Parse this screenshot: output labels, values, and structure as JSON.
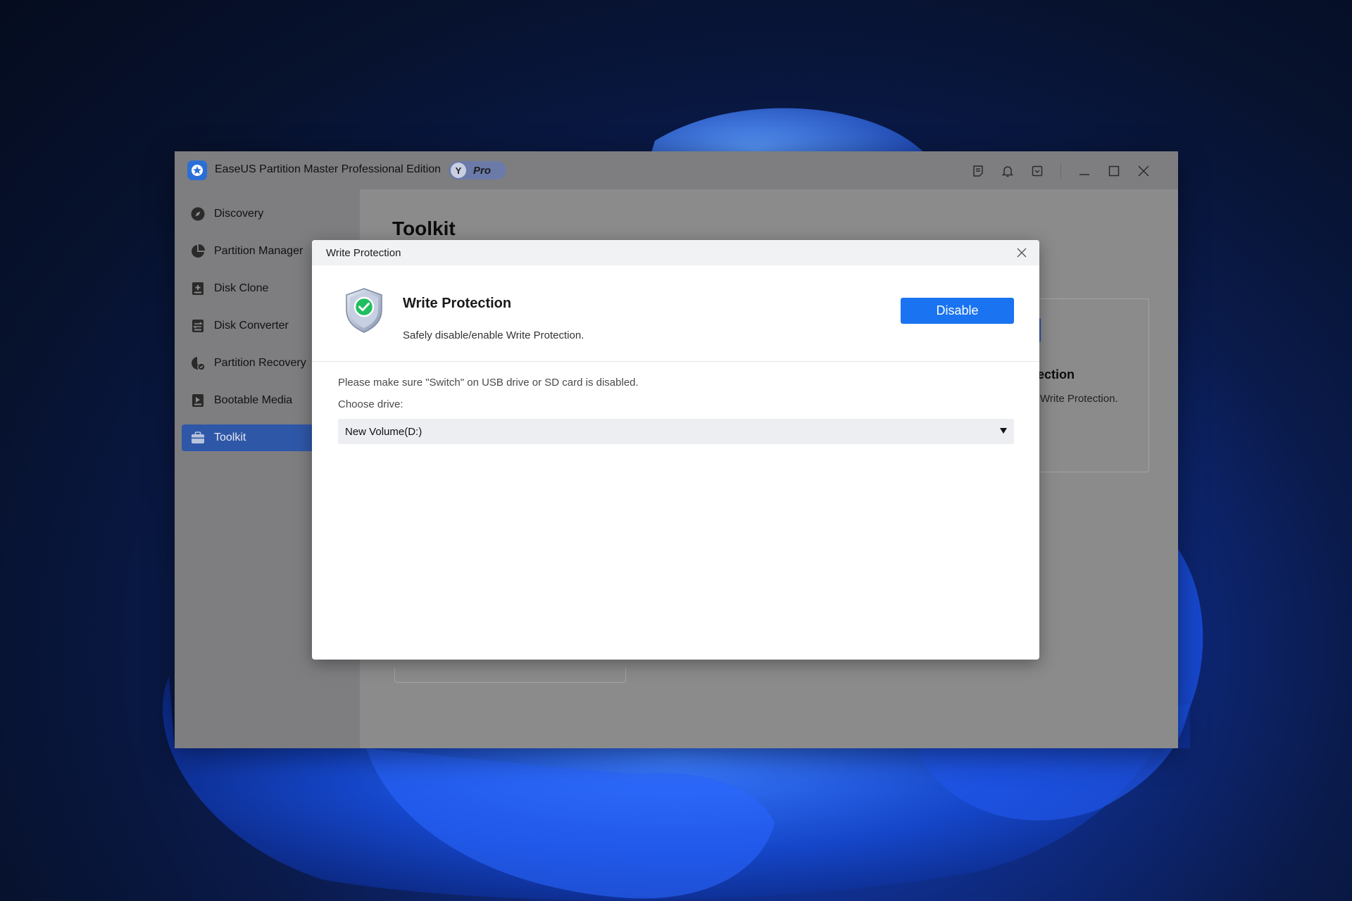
{
  "window": {
    "title": "EaseUS Partition Master Professional Edition",
    "badge_letter": "Y",
    "badge_label": "Pro"
  },
  "sidebar": {
    "items": [
      {
        "label": "Discovery",
        "icon": "compass-icon"
      },
      {
        "label": "Partition Manager",
        "icon": "pie-chart-icon"
      },
      {
        "label": "Disk Clone",
        "icon": "disk-clone-icon"
      },
      {
        "label": "Disk Converter",
        "icon": "disk-converter-icon"
      },
      {
        "label": "Partition Recovery",
        "icon": "partition-recovery-icon"
      },
      {
        "label": "Bootable Media",
        "icon": "bootable-media-icon"
      },
      {
        "label": "Toolkit",
        "icon": "toolbox-icon"
      }
    ],
    "active": "Toolkit"
  },
  "main": {
    "title": "Toolkit",
    "card_title_fragment": "ection",
    "card_desc_fragment": "Write Protection."
  },
  "dialog": {
    "title": "Write Protection",
    "feature_title": "Write Protection",
    "feature_desc": "Safely disable/enable Write Protection.",
    "action_label": "Disable",
    "note": "Please make sure \"Switch\" on USB drive or SD card is disabled.",
    "choose_label": "Choose drive:",
    "selected_drive": "New Volume(D:)"
  },
  "colors": {
    "accent": "#1a73f0",
    "active_nav": "#2f57a8",
    "overlay_bg": "#7e7e80"
  }
}
